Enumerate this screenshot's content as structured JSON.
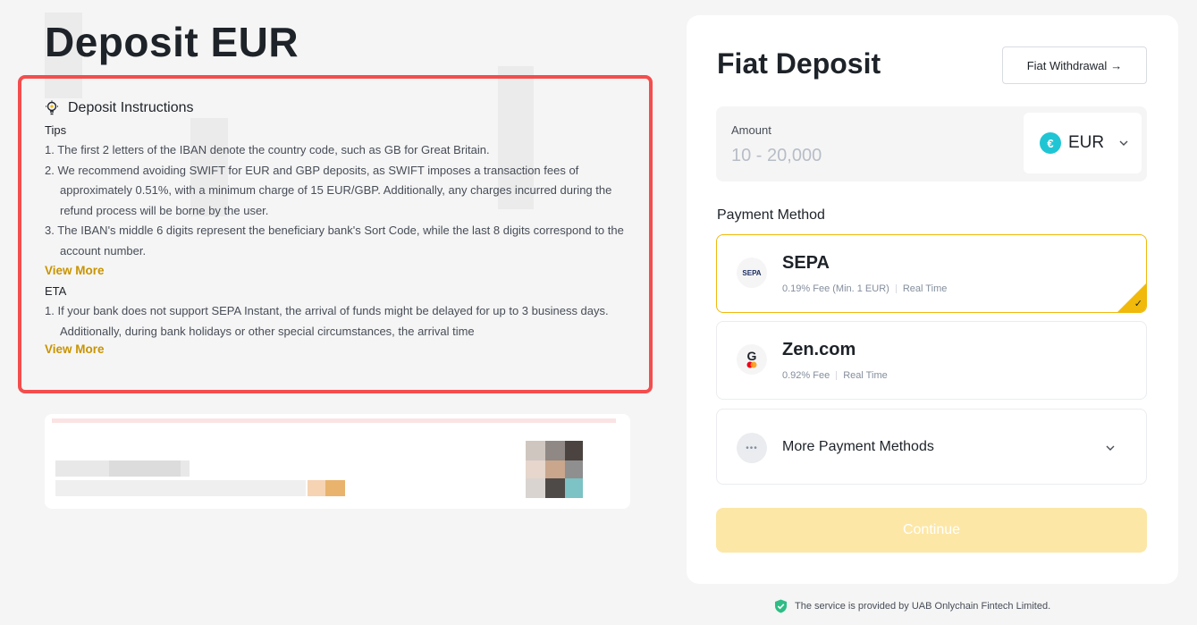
{
  "page": {
    "title": "Deposit EUR"
  },
  "instructions": {
    "heading": "Deposit Instructions",
    "tips_label": "Tips",
    "tips": [
      "1. The first 2 letters of the IBAN denote the country code, such as GB for Great Britain.",
      "2. We recommend avoiding SWIFT for EUR and GBP deposits, as SWIFT imposes a transaction fees of approximately 0.51%, with a minimum charge of 15 EUR/GBP. Additionally, any charges incurred during the refund process will be borne by the user.",
      "3. The IBAN's middle 6 digits represent the beneficiary bank's Sort Code, while the last 8 digits correspond to the account number."
    ],
    "view_more_1": "View More",
    "eta_label": "ETA",
    "eta": [
      "1. If your bank does not support SEPA Instant, the arrival of funds might be delayed for up to 3 business days. Additionally, during bank holidays or other special circumstances, the arrival time"
    ],
    "view_more_2": "View More"
  },
  "panel": {
    "title": "Fiat Deposit",
    "withdraw_label": "Fiat Withdrawal",
    "withdraw_arrow": "→",
    "amount": {
      "label": "Amount",
      "placeholder": "10 - 20,000",
      "currency": "EUR",
      "currency_symbol": "€"
    },
    "payment_method_label": "Payment Method",
    "methods": [
      {
        "name": "SEPA",
        "logo_text": "SEPA",
        "fee": "0.19% Fee (Min. 1 EUR)",
        "speed": "Real Time",
        "selected": true
      },
      {
        "name": "Zen.com",
        "logo_text": "G",
        "fee": "0.92% Fee",
        "speed": "Real Time",
        "selected": false
      }
    ],
    "more_methods": "More Payment Methods",
    "continue": "Continue"
  },
  "footer": {
    "note": "The service is provided by UAB Onlychain Fintech Limited."
  },
  "colors": {
    "accent": "#f0b90b",
    "link": "#c99400",
    "highlight_border": "#f44d4d",
    "eur": "#20c5d4",
    "continue_disabled": "#fce7a7"
  },
  "icons": [
    "lightbulb-icon",
    "chevron-down-icon",
    "checkmark-icon",
    "more-dots-icon",
    "shield-check-icon",
    "arrow-right-icon"
  ]
}
